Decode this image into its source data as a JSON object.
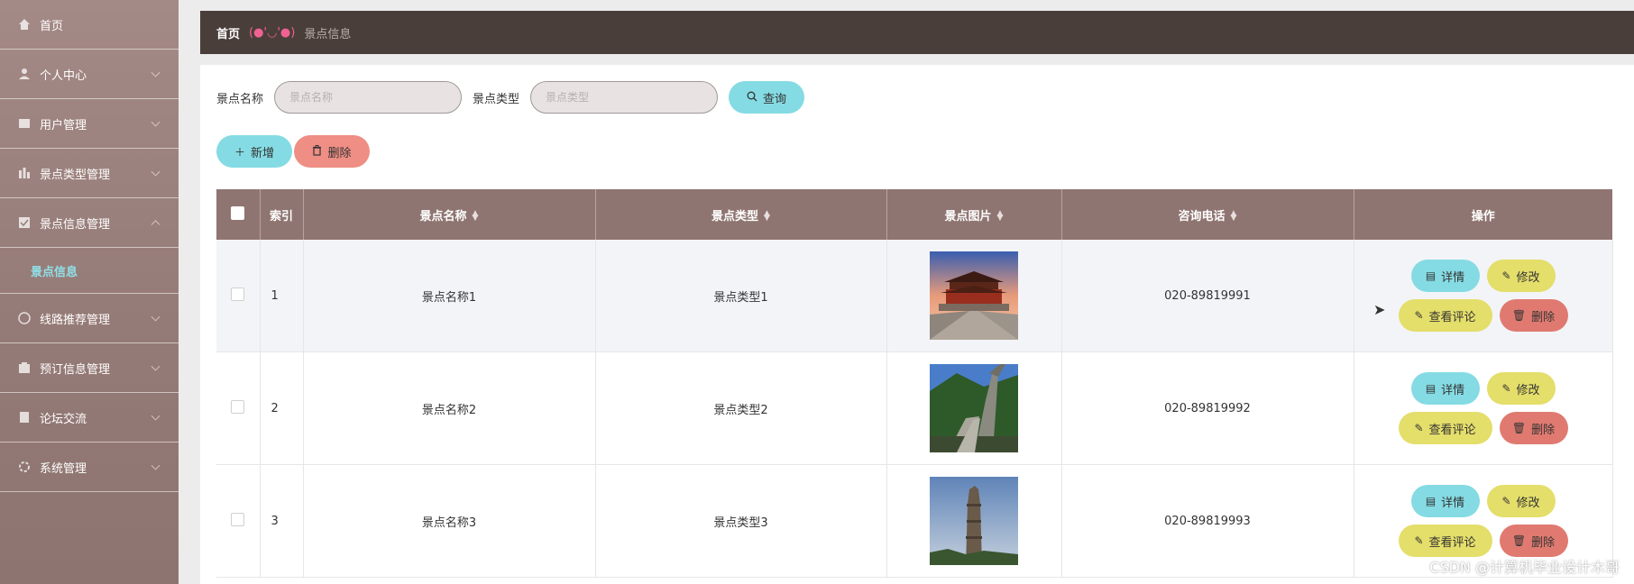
{
  "sidebar": {
    "items": [
      {
        "label": "首页",
        "icon": "home-icon"
      },
      {
        "label": "个人中心",
        "icon": "user-icon"
      },
      {
        "label": "用户管理",
        "icon": "users-icon"
      },
      {
        "label": "景点类型管理",
        "icon": "grid-icon"
      },
      {
        "label": "景点信息管理",
        "icon": "list-icon"
      }
    ],
    "subitem": "景点信息",
    "items2": [
      {
        "label": "线路推荐管理",
        "icon": "route-icon"
      },
      {
        "label": "预订信息管理",
        "icon": "order-icon"
      },
      {
        "label": "论坛交流",
        "icon": "forum-icon"
      },
      {
        "label": "系统管理",
        "icon": "settings-icon"
      }
    ]
  },
  "breadcrumb": {
    "home": "首页",
    "sep": "(●'◡'●)",
    "current": "景点信息"
  },
  "search": {
    "name_label": "景点名称",
    "name_placeholder": "景点名称",
    "type_label": "景点类型",
    "type_placeholder": "景点类型",
    "query_label": "查询"
  },
  "actions": {
    "add_label": "新增",
    "delete_label": "删除"
  },
  "table": {
    "headers": {
      "index": "索引",
      "name": "景点名称",
      "type": "景点类型",
      "image": "景点图片",
      "phone": "咨询电话",
      "ops": "操作"
    },
    "rows": [
      {
        "index": "1",
        "name": "景点名称1",
        "type": "景点类型1",
        "image": "palace-photo",
        "phone": "020-89819991"
      },
      {
        "index": "2",
        "name": "景点名称2",
        "type": "景点类型2",
        "image": "great-wall-photo",
        "phone": "020-89819992"
      },
      {
        "index": "3",
        "name": "景点名称3",
        "type": "景点类型3",
        "image": "pagoda-photo",
        "phone": "020-89819993"
      }
    ],
    "row_buttons": {
      "detail": "详情",
      "edit": "修改",
      "comments": "查看评论",
      "delete": "删除"
    }
  },
  "watermark": "CSDN @计算机毕业设计木哥",
  "colors": {
    "sidebar": "#957b77",
    "topbar": "#4a3e3b",
    "header": "#8f7571",
    "cyan": "#85dbe3",
    "yellow": "#e4de6a",
    "red": "#ee8e84"
  }
}
